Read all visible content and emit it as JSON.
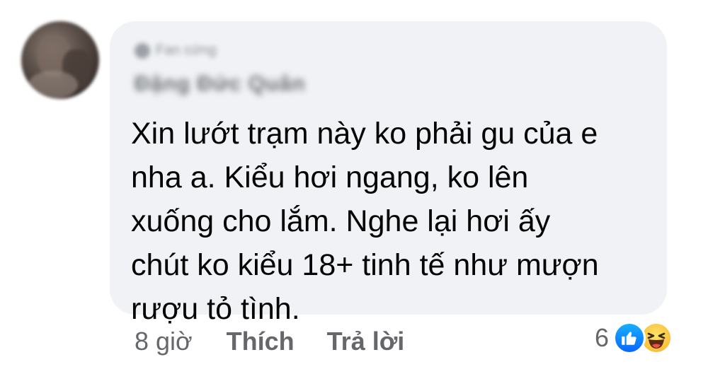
{
  "comment": {
    "badge_label": "Fan cứng",
    "author_name": "Đặng Đức Quân",
    "text_lines": [
      "Xin lướt trạm này ko phải gu của e",
      "nha a. Kiểu hơi ngang, ko lên",
      "xuống cho lắm. Nghe lại hơi ấy",
      "chút ko kiểu 18+ tinh tế như mượn",
      "rượu tỏ tình."
    ]
  },
  "actions": {
    "time": "8 giờ",
    "like_label": "Thích",
    "reply_label": "Trả lời"
  },
  "reactions": {
    "count": "6",
    "icons": [
      "like-icon",
      "haha-icon"
    ],
    "like_color": "#0866ff",
    "haha_color": "#f7b125"
  },
  "colors": {
    "bubble_bg": "#f0f2f5",
    "text": "#050505",
    "secondary_text": "#65676b"
  }
}
